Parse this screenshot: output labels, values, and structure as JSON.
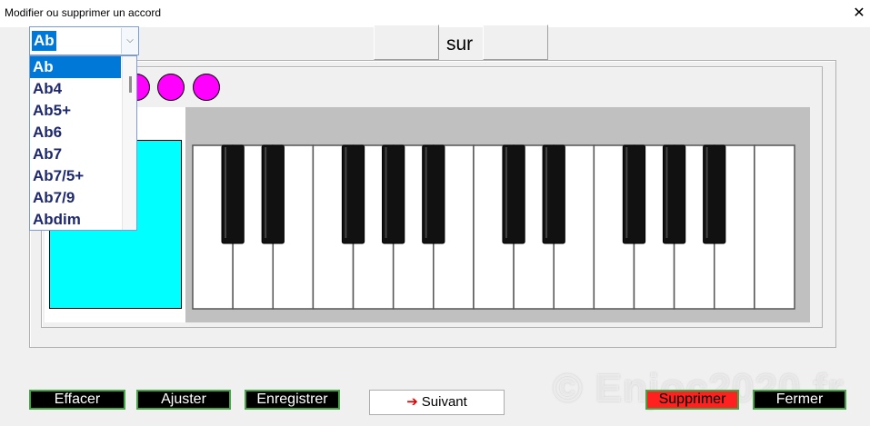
{
  "window": {
    "title": "Modifier ou supprimer un accord",
    "close_glyph": "✕"
  },
  "chord_select": {
    "value": "Ab",
    "arrow_glyph": "⌵",
    "options": [
      "Ab",
      "Ab4",
      "Ab5+",
      "Ab6",
      "Ab7",
      "Ab7/5+",
      "Ab7/9",
      "Abdim"
    ]
  },
  "bass": {
    "sur_label": "sur",
    "left_value": "",
    "right_value": ""
  },
  "piano": {
    "white_key_count": 15,
    "black_key_count": 10,
    "selected_dots": 3
  },
  "buttons": {
    "effacer": "Effacer",
    "ajuster": "Ajuster",
    "enregistrer": "Enregistrer",
    "suivant": "Suivant",
    "suivant_arrow": "➔",
    "supprimer": "Supprimer",
    "fermer": "Fermer"
  },
  "watermark": "© Enjoc2020.fr",
  "colors": {
    "dot": "#ff00ff",
    "chord_box": "#00ffff",
    "button_green_border": "#46a346",
    "supprimer_bg": "#ff2020",
    "selection": "#0078d7"
  }
}
